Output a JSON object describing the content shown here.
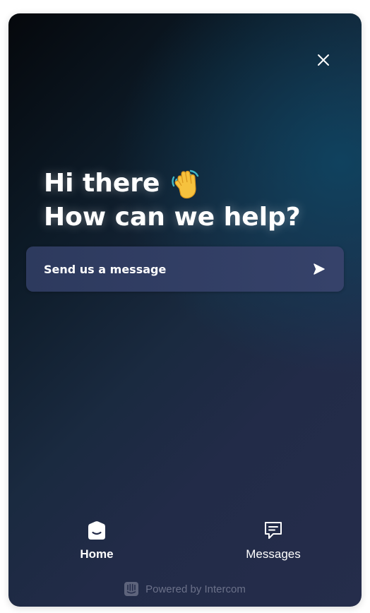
{
  "header": {
    "close_icon": "close-icon"
  },
  "greeting": {
    "line1": "Hi there",
    "line2": "How can we help?",
    "emoji_icon": "waving-hand-icon"
  },
  "message_card": {
    "label": "Send us a message",
    "icon": "send-arrow-icon"
  },
  "nav": {
    "items": [
      {
        "label": "Home",
        "icon": "home-icon",
        "active": true
      },
      {
        "label": "Messages",
        "icon": "messages-icon",
        "active": false
      }
    ]
  },
  "footer": {
    "text": "Powered by Intercom",
    "logo_icon": "intercom-logo-icon"
  },
  "colors": {
    "text": "#ffffff",
    "card": "#323e64",
    "footer_text": "#6b7189",
    "background_dark": "#05080c",
    "background_navy": "#252d4b"
  }
}
